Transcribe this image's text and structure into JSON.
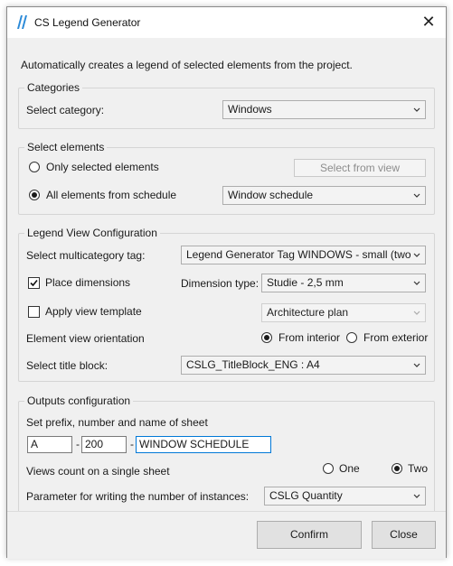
{
  "window": {
    "title": "CS Legend Generator",
    "description": "Automatically creates a legend of selected elements from the project."
  },
  "categories": {
    "legend": "Categories",
    "select_label": "Select category:",
    "select_value": "Windows"
  },
  "select_elements": {
    "legend": "Select elements",
    "only_selected_label": "Only selected elements",
    "only_selected_checked": false,
    "select_from_view_label": "Select from view",
    "all_from_schedule_label": "All elements from schedule",
    "all_from_schedule_checked": true,
    "schedule_value": "Window schedule"
  },
  "legend_view": {
    "legend": "Legend View Configuration",
    "tag_label": "Select multicategory tag:",
    "tag_value": "Legend Generator Tag WINDOWS - small (two",
    "place_dimensions_label": "Place dimensions",
    "place_dimensions_checked": true,
    "dimension_type_label": "Dimension type:",
    "dimension_type_value": "Studie - 2,5 mm",
    "apply_view_template_label": "Apply view template",
    "apply_view_template_checked": false,
    "view_template_value": "Architecture plan",
    "orientation_label": "Element view orientation",
    "from_interior_label": "From interior",
    "from_interior_checked": true,
    "from_exterior_label": "From exterior",
    "from_exterior_checked": false,
    "title_block_label": "Select title block:",
    "title_block_value": "CSLG_TitleBlock_ENG : A4"
  },
  "outputs": {
    "legend": "Outputs configuration",
    "prefix_label": "Set prefix, number and name of sheet",
    "prefix_value": "A",
    "separator1": "-",
    "number_value": "200",
    "separator2": "-",
    "name_value": "WINDOW SCHEDULE",
    "views_count_label": "Views count on a single sheet",
    "one_label": "One",
    "one_checked": false,
    "two_label": "Two",
    "two_checked": true,
    "parameter_label": "Parameter for writing the number of instances:",
    "parameter_value": "CSLG Quantity"
  },
  "footer": {
    "confirm_label": "Confirm",
    "close_label": "Close"
  },
  "colors": {
    "accent": "#0078d7",
    "icon": "#2b8ad8",
    "panel": "#f0f0f0"
  }
}
